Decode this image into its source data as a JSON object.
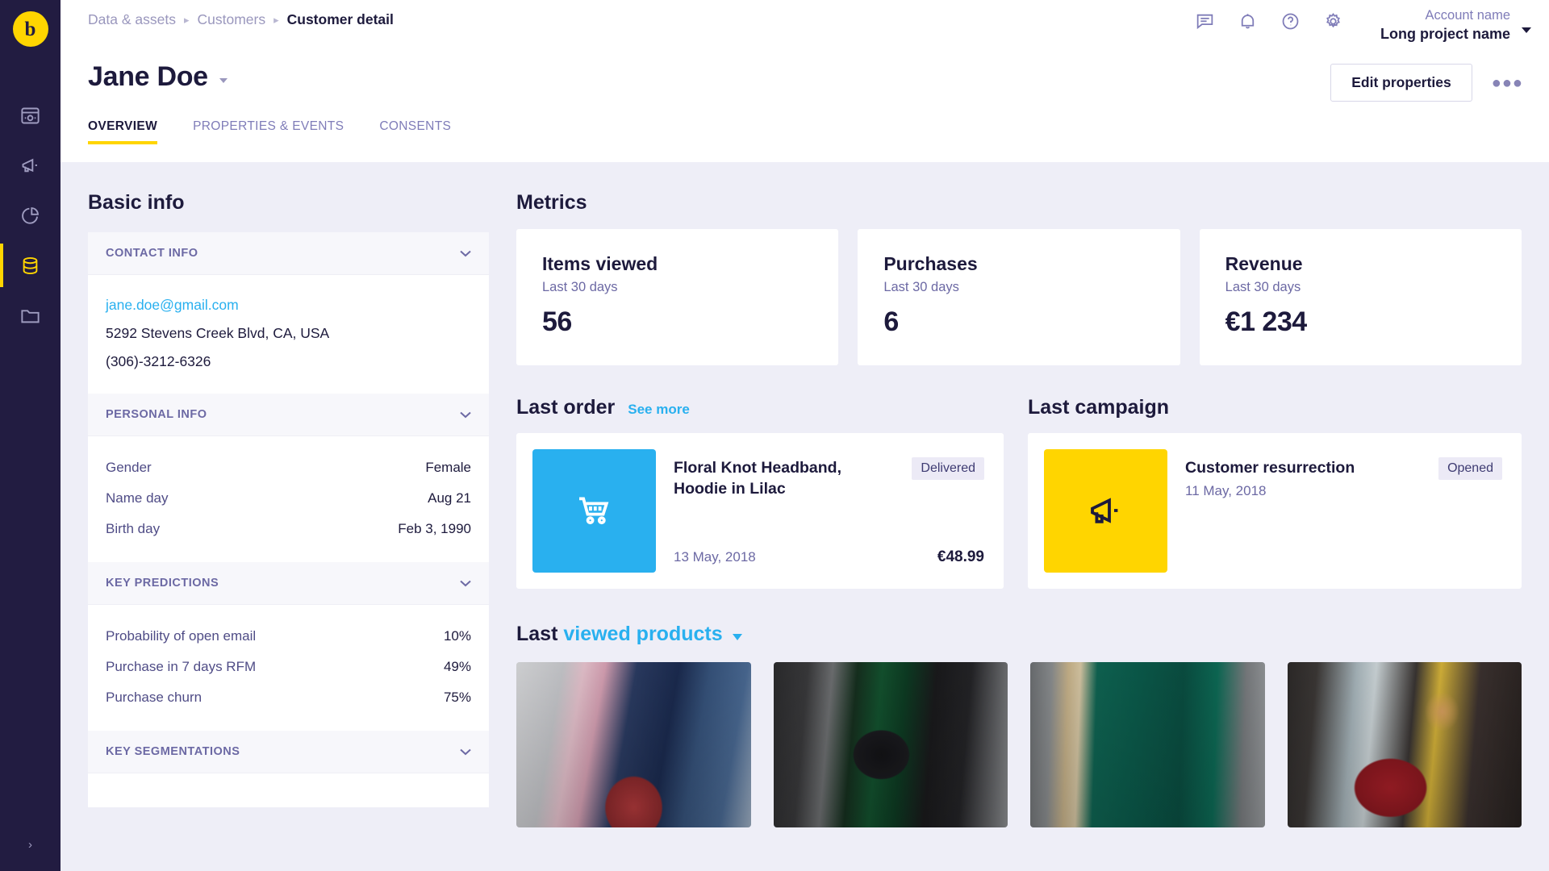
{
  "rail": {
    "logo_letter": "b",
    "items": [
      {
        "name": "dashboard",
        "icon": "dashboard-icon",
        "active": false
      },
      {
        "name": "campaigns",
        "icon": "megaphone-icon",
        "active": false
      },
      {
        "name": "analytics",
        "icon": "pie-chart-icon",
        "active": false
      },
      {
        "name": "data-assets",
        "icon": "database-icon",
        "active": true
      },
      {
        "name": "files",
        "icon": "folder-icon",
        "active": false
      }
    ],
    "expand_label": "›"
  },
  "header": {
    "breadcrumb": [
      "Data & assets",
      "Customers",
      "Customer detail"
    ],
    "icons": [
      "chat-icon",
      "bell-icon",
      "help-icon",
      "gear-icon"
    ],
    "account_name": "Account name",
    "project_name": "Long project name",
    "page_title": "Jane Doe",
    "edit_button": "Edit properties",
    "more_button": "●●●",
    "tabs": [
      {
        "label": "OVERVIEW",
        "active": true
      },
      {
        "label": "PROPERTIES & EVENTS",
        "active": false
      },
      {
        "label": "CONSENTS",
        "active": false
      }
    ]
  },
  "basic_info": {
    "title": "Basic info",
    "groups": [
      {
        "label": "CONTACT INFO",
        "type": "lines",
        "lines": [
          {
            "text": "jane.doe@gmail.com",
            "style": "email"
          },
          {
            "text": "5292 Stevens Creek Blvd, CA, USA",
            "style": "plain"
          },
          {
            "text": "(306)-3212-6326",
            "style": "plain"
          }
        ]
      },
      {
        "label": "PERSONAL INFO",
        "type": "kv",
        "rows": [
          {
            "key": "Gender",
            "value": "Female"
          },
          {
            "key": "Name day",
            "value": "Aug 21"
          },
          {
            "key": "Birth day",
            "value": "Feb 3, 1990"
          }
        ]
      },
      {
        "label": "KEY PREDICTIONS",
        "type": "kv",
        "rows": [
          {
            "key": "Probability of open email",
            "value": "10%"
          },
          {
            "key": "Purchase in 7 days RFM",
            "value": "49%"
          },
          {
            "key": "Purchase churn",
            "value": "75%"
          }
        ]
      },
      {
        "label": "KEY SEGMENTATIONS",
        "type": "kv",
        "rows": []
      }
    ]
  },
  "metrics": {
    "title": "Metrics",
    "cards": [
      {
        "name": "Items viewed",
        "period": "Last 30 days",
        "value": "56"
      },
      {
        "name": "Purchases",
        "period": "Last 30 days",
        "value": "6"
      },
      {
        "name": "Revenue",
        "period": "Last 30 days",
        "value": "€1 234"
      }
    ]
  },
  "last_order": {
    "title": "Last order",
    "see_more": "See more",
    "icon": "shopping-cart-icon",
    "product": "Floral Knot Headband, Hoodie in Lilac",
    "status": "Delivered",
    "date": "13 May, 2018",
    "price": "€48.99"
  },
  "last_campaign": {
    "title": "Last campaign",
    "icon": "megaphone-icon",
    "name": "Customer resurrection",
    "status": "Opened",
    "date": "11 May, 2018"
  },
  "last_viewed": {
    "prefix": "Last",
    "selector": "viewed products",
    "products": [
      {
        "name": "product-thumb-1"
      },
      {
        "name": "product-thumb-2"
      },
      {
        "name": "product-thumb-3"
      },
      {
        "name": "product-thumb-4"
      }
    ]
  },
  "colors": {
    "brand_yellow": "#ffd500",
    "accent_blue": "#29b0ef",
    "rail_dark": "#221c41",
    "page_bg": "#eeeef7",
    "text_dark": "#1d1a3c",
    "text_muted": "#6c69a4"
  }
}
